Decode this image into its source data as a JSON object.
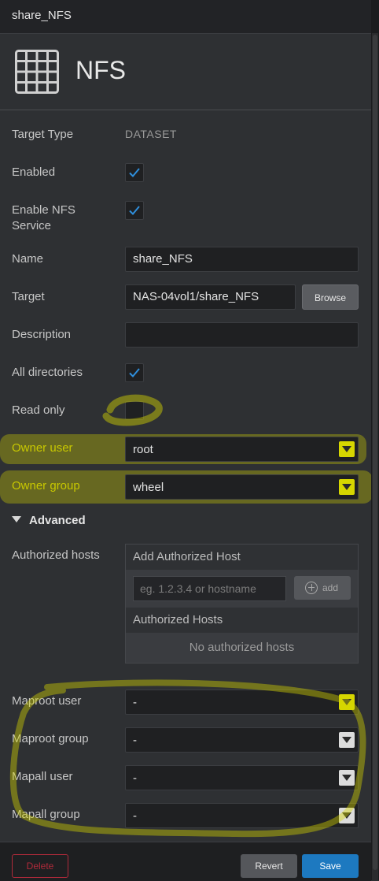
{
  "window": {
    "title": "share_NFS"
  },
  "header": {
    "title": "NFS",
    "icon": "grid-icon"
  },
  "fields": {
    "target_type": {
      "label": "Target Type",
      "value": "DATASET"
    },
    "enabled": {
      "label": "Enabled",
      "checked": true
    },
    "enable_nfs": {
      "label_line1": "Enable NFS",
      "label_line2": "Service",
      "checked": true
    },
    "name": {
      "label": "Name",
      "value": "share_NFS"
    },
    "target": {
      "label": "Target",
      "value": "NAS-04vol1/share_NFS",
      "browse_label": "Browse"
    },
    "description": {
      "label": "Description",
      "value": ""
    },
    "all_directories": {
      "label": "All directories",
      "checked": true
    },
    "read_only": {
      "label": "Read only",
      "checked": false
    },
    "owner_user": {
      "label": "Owner user",
      "value": "root"
    },
    "owner_group": {
      "label": "Owner group",
      "value": "wheel"
    }
  },
  "advanced": {
    "label": "Advanced",
    "authorized_hosts": {
      "label": "Authorized hosts",
      "add_header": "Add Authorized Host",
      "placeholder": "eg. 1.2.3.4 or hostname",
      "add_label": "add",
      "list_header": "Authorized Hosts",
      "empty_text": "No authorized hosts"
    },
    "maproot_user": {
      "label": "Maproot user",
      "value": "-"
    },
    "maproot_group": {
      "label": "Maproot group",
      "value": "-"
    },
    "mapall_user": {
      "label": "Mapall user",
      "value": "-"
    },
    "mapall_group": {
      "label": "Mapall group",
      "value": "-"
    }
  },
  "footer": {
    "delete_label": "Delete",
    "revert_label": "Revert",
    "save_label": "Save"
  },
  "colors": {
    "accent": "#1d79c0",
    "highlight": "#d6d600",
    "danger": "#b02a3a"
  }
}
